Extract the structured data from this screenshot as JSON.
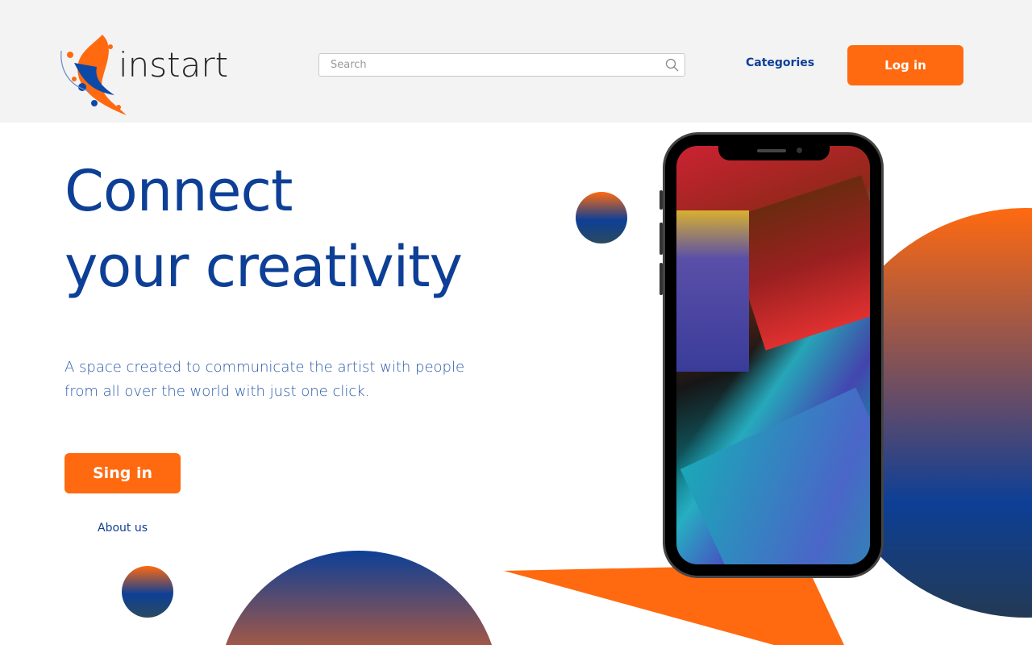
{
  "header": {
    "brand": "instart",
    "search_placeholder": "Search",
    "categories_label": "Categories",
    "login_label": "Log in"
  },
  "hero": {
    "title_line1": "Connect",
    "title_line2": "your creativity",
    "description": "A space created to communicate the artist with people from all over the world with just one click.",
    "signin_label": "Sing in",
    "about_label": "About us"
  },
  "colors": {
    "accent": "#ff6a10",
    "brand_blue": "#0d3f96"
  }
}
